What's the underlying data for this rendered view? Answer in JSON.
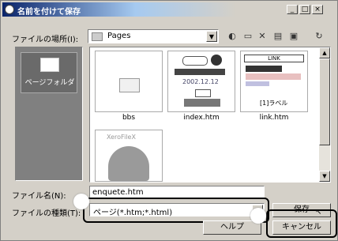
{
  "window": {
    "title": "名前を付けて保存",
    "min": "_",
    "max": "□",
    "close": "×"
  },
  "location": {
    "label": "ファイルの場所(I):",
    "value": "Pages"
  },
  "places": {
    "item": "ページフォルダ"
  },
  "files": [
    {
      "name": "bbs"
    },
    {
      "name": "index.htm",
      "lines": [
        "2002.12.12"
      ]
    },
    {
      "name": "link.htm",
      "lines": [
        "LINK",
        "[1]ラベル"
      ]
    },
    {
      "name": "",
      "lines": [
        "XeroFileX"
      ]
    }
  ],
  "filename": {
    "label": "ファイル名(N):",
    "value": "enquete.htm"
  },
  "filetype": {
    "label": "ファイルの種類(T):",
    "value": "ページ(*.htm;*.html)"
  },
  "buttons": {
    "save": "保存",
    "cancel": "キャンセル",
    "help": "ヘルプ"
  }
}
